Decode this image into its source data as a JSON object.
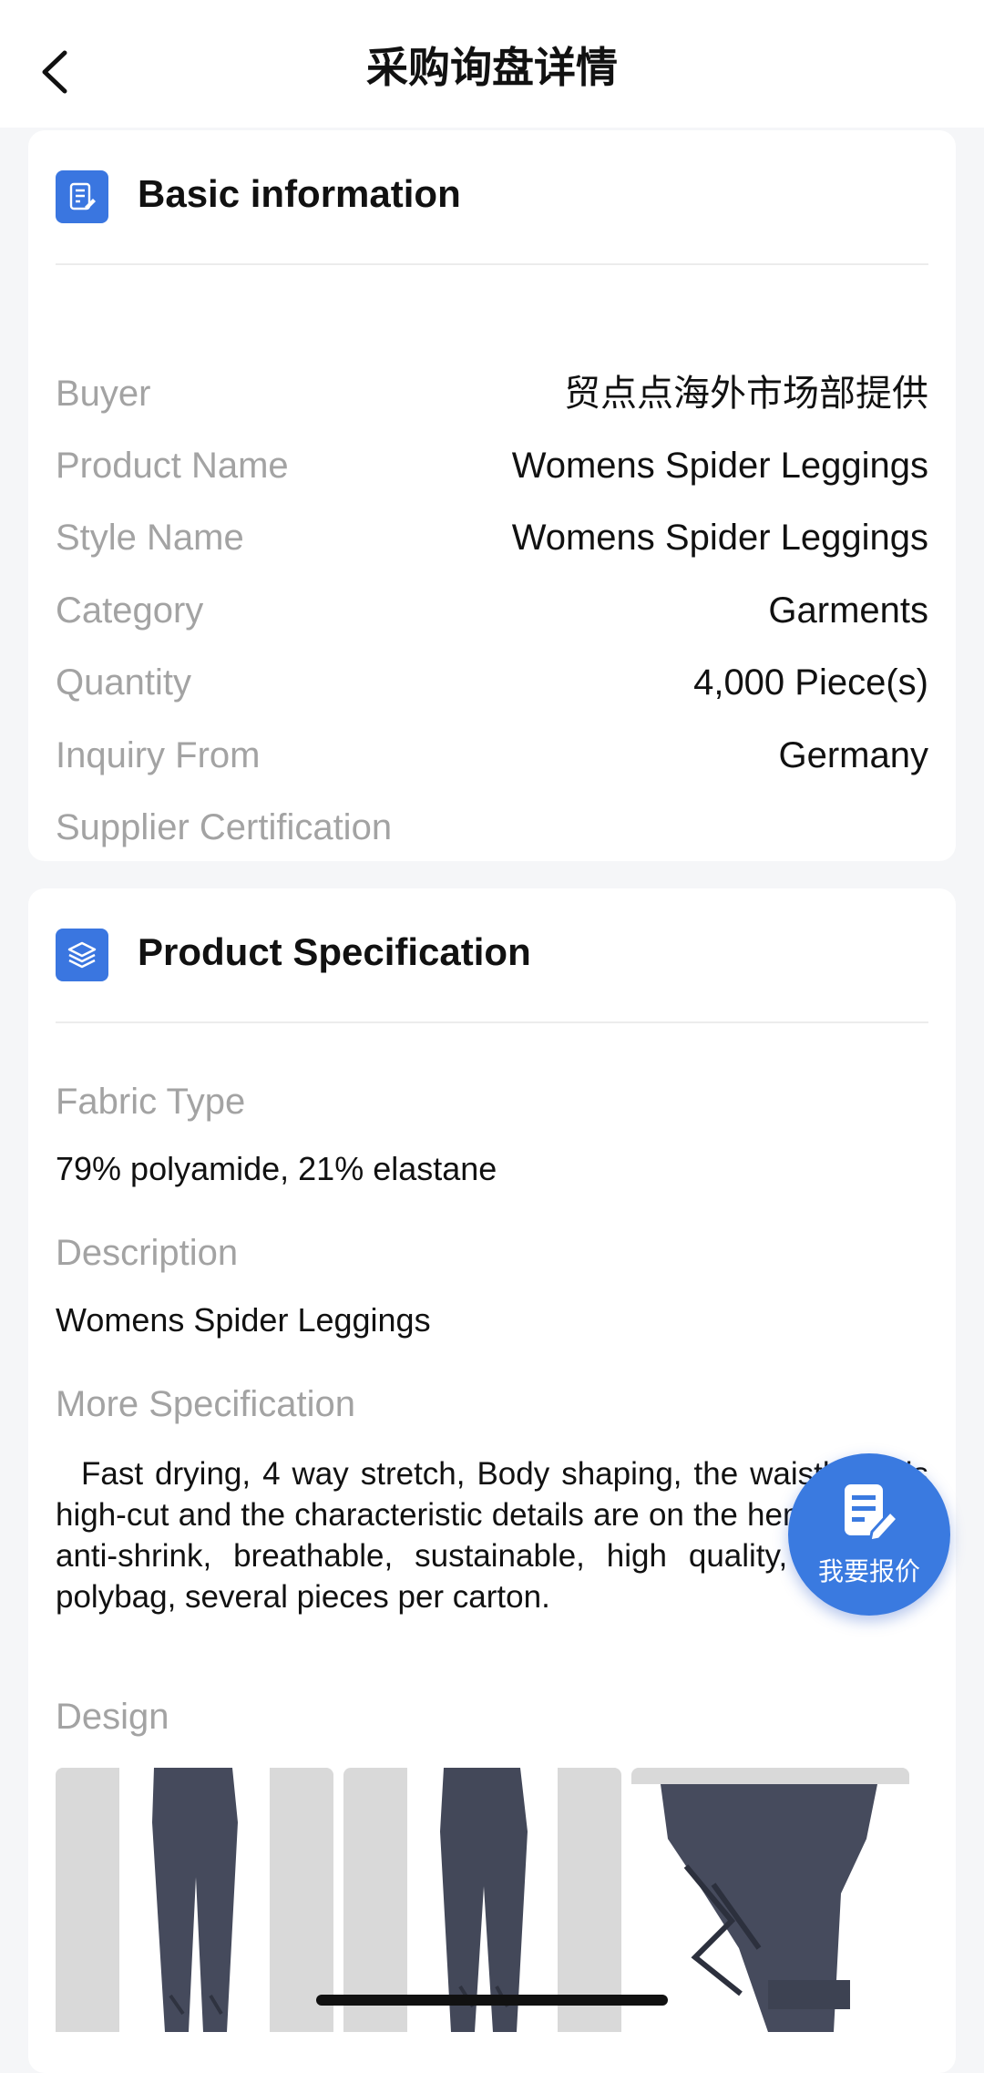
{
  "header": {
    "title": "采购询盘详情"
  },
  "basic_info": {
    "title": "Basic information",
    "rows": [
      {
        "label": "Buyer",
        "value": "贸点点海外市场部提供"
      },
      {
        "label": "Product Name",
        "value": "Womens Spider Leggings"
      },
      {
        "label": "Style Name",
        "value": "Womens Spider Leggings"
      },
      {
        "label": "Category",
        "value": "Garments"
      },
      {
        "label": "Quantity",
        "value": "4,000 Piece(s)"
      },
      {
        "label": "Inquiry From",
        "value": "Germany"
      },
      {
        "label": "Supplier Certification",
        "value": ""
      }
    ]
  },
  "spec": {
    "title": "Product Specification",
    "fabric_label": "Fabric Type",
    "fabric_value": "79% polyamide, 21% elastane",
    "description_label": "Description",
    "description_value": "Womens Spider Leggings",
    "more_label": "More Specification",
    "more_value": "Fast drying, 4 way stretch, Body shaping, the waistband is high-cut and the characteristic details are on the hem, casual, anti-shrink, breathable, sustainable, high quality, 1pc per polybag, several pieces per carton.",
    "design_label": "Design"
  },
  "fab": {
    "label": "我要报价"
  },
  "colors": {
    "accent": "#3a76e0",
    "label_gray": "#a3a3a3",
    "background": "#f5f6f8"
  }
}
